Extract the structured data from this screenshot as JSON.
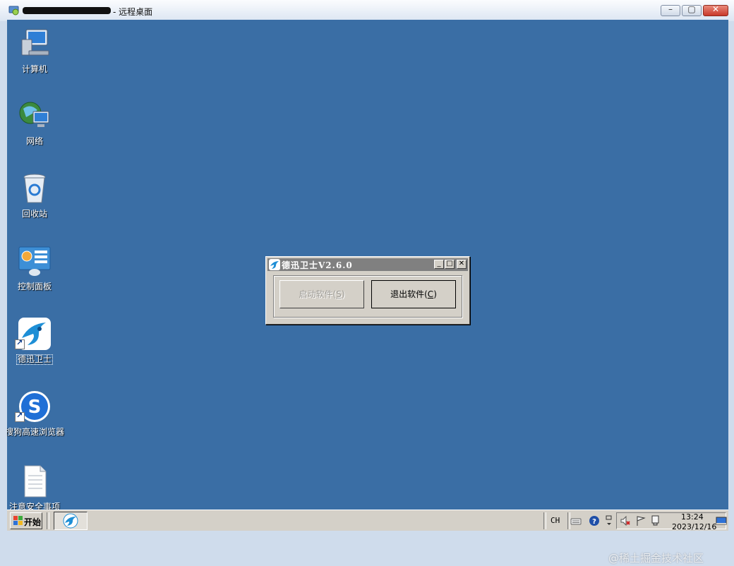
{
  "window": {
    "title": "- 远程桌面",
    "controls": {
      "minimize": "–",
      "maximize": "▢",
      "close": "✕"
    }
  },
  "desktop": {
    "background_color": "#3a6ea5",
    "icons": [
      {
        "label": "计算机",
        "icon": "computer-icon"
      },
      {
        "label": "网络",
        "icon": "network-icon"
      },
      {
        "label": "回收站",
        "icon": "recycle-bin-icon"
      },
      {
        "label": "控制面板",
        "icon": "control-panel-icon"
      },
      {
        "label": "德迅卫士",
        "icon": "dexun-shortcut-icon"
      },
      {
        "label": "搜狗高速浏览器",
        "icon": "sogou-browser-icon"
      },
      {
        "label": "注意安全事项",
        "icon": "text-document-icon"
      }
    ]
  },
  "dialog": {
    "title": "德迅卫士V2.6.0",
    "start_button": {
      "label": "启动软件(",
      "accel": "S",
      "suffix": ")",
      "enabled": false
    },
    "exit_button": {
      "label": "退出软件(",
      "accel": "C",
      "suffix": ")",
      "enabled": true
    },
    "controls": {
      "minimize": "_",
      "maximize": "□",
      "close": "✕"
    }
  },
  "taskbar": {
    "start_label": "开始",
    "language": "CH",
    "clock_time": "13:24",
    "clock_date": "2023/12/16"
  },
  "watermark": "@稀土掘金技术社区"
}
